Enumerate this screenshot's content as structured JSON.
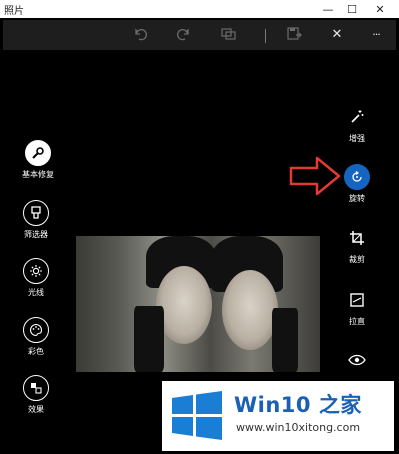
{
  "app": {
    "title": "照片"
  },
  "window_controls": {
    "minimize": "—",
    "maximize": "☐",
    "close": "✕"
  },
  "toolbar": {
    "undo_icon": "undo-icon",
    "redo_icon": "redo-icon",
    "compare_icon": "compare-icon",
    "save_copy_icon": "save-copy-icon",
    "close_glyph": "✕",
    "more_glyph": "···"
  },
  "left_tools": [
    {
      "label": "基本修复",
      "icon": "wrench-icon",
      "selected": true
    },
    {
      "label": "筛选器",
      "icon": "filter-icon"
    },
    {
      "label": "光线",
      "icon": "brightness-icon"
    },
    {
      "label": "彩色",
      "icon": "palette-icon"
    },
    {
      "label": "效果",
      "icon": "effects-icon"
    }
  ],
  "right_tools": [
    {
      "label": "增强",
      "icon": "magic-wand-icon"
    },
    {
      "label": "旋转",
      "icon": "rotate-icon",
      "active": true
    },
    {
      "label": "裁剪",
      "icon": "crop-icon"
    },
    {
      "label": "拉直",
      "icon": "straighten-icon"
    },
    {
      "label": "",
      "icon": "red-eye-icon"
    }
  ],
  "watermark": {
    "brand": "Win10 之家",
    "url": "www.win10xitong.com"
  },
  "colors": {
    "accent": "#1565c0",
    "arrow": "#e53935",
    "background": "#000000"
  }
}
